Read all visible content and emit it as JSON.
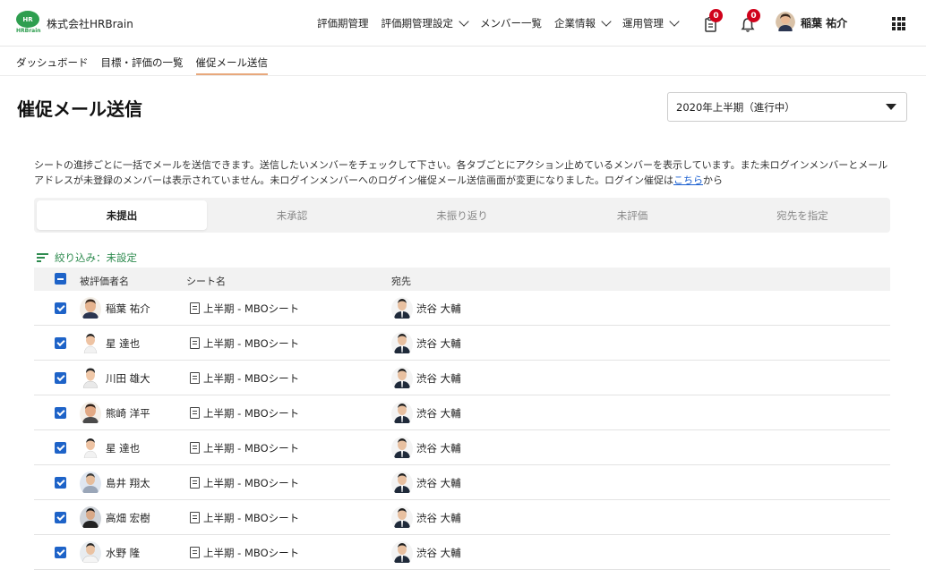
{
  "header": {
    "logo_text": "HR",
    "logo_sub": "HRBrain",
    "company": "株式会社HRBrain",
    "nav": [
      {
        "label": "評価期管理",
        "has_dropdown": false
      },
      {
        "label": "評価期管理設定",
        "has_dropdown": true
      },
      {
        "label": "メンバー一覧",
        "has_dropdown": false
      },
      {
        "label": "企業情報",
        "has_dropdown": true
      },
      {
        "label": "運用管理",
        "has_dropdown": true
      }
    ],
    "tasks_badge": "0",
    "notifications_badge": "0",
    "user_name": "稲葉 祐介"
  },
  "breadcrumb": [
    "ダッシュボード",
    "目標・評価の一覧",
    "催促メール送信"
  ],
  "page": {
    "title": "催促メール送信",
    "period": "2020年上半期（進行中）",
    "description_main": "シートの進捗ごとに一括でメールを送信できます。送信したいメンバーをチェックして下さい。各タブごとにアクション止めているメンバーを表示しています。また未ログインメンバーとメールアドレスが未登録のメンバーは表示されていません。未ログインメンバーへのログイン催促メール送信画面が変更になりました。ログイン催促は",
    "description_link": "こちら",
    "description_tail": "から"
  },
  "tabs": [
    "未提出",
    "未承認",
    "未振り返り",
    "未評価",
    "宛先を指定"
  ],
  "filter_label": "絞り込み：未設定",
  "table": {
    "columns": [
      "被評価者名",
      "シート名",
      "宛先"
    ],
    "rows": [
      {
        "name": "稲葉 祐介",
        "sheet": "上半期 - MBOシート",
        "recipient": "渋谷 大輔"
      },
      {
        "name": "星 達也",
        "sheet": "上半期 - MBOシート",
        "recipient": "渋谷 大輔"
      },
      {
        "name": "川田 雄大",
        "sheet": "上半期 - MBOシート",
        "recipient": "渋谷 大輔"
      },
      {
        "name": "熊崎 洋平",
        "sheet": "上半期 - MBOシート",
        "recipient": "渋谷 大輔"
      },
      {
        "name": "星 達也",
        "sheet": "上半期 - MBOシート",
        "recipient": "渋谷 大輔"
      },
      {
        "name": "島井 翔太",
        "sheet": "上半期 - MBOシート",
        "recipient": "渋谷 大輔"
      },
      {
        "name": "高畑 宏樹",
        "sheet": "上半期 - MBOシート",
        "recipient": "渋谷 大輔"
      },
      {
        "name": "水野 隆",
        "sheet": "上半期 - MBOシート",
        "recipient": "渋谷 大輔"
      }
    ]
  },
  "colors": {
    "brand": "#2e9e4f",
    "checkbox": "#1e63c8",
    "badge": "#d0021b",
    "link": "#1a5fd0"
  }
}
